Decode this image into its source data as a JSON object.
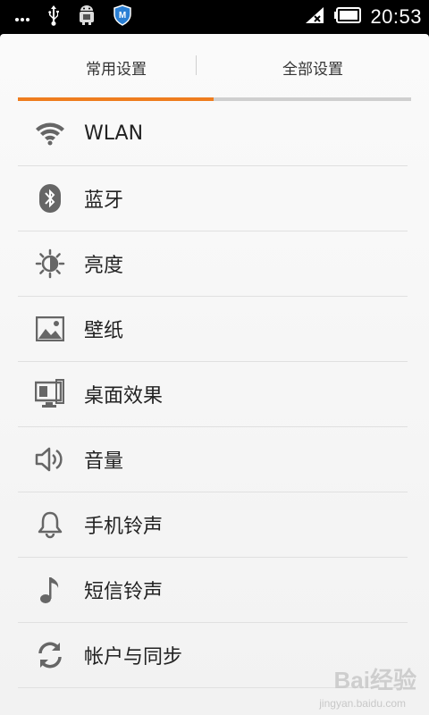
{
  "statusbar": {
    "time": "20:53",
    "left_icons": [
      "more-dots-icon",
      "usb-icon",
      "android-debug-icon",
      "security-shield-icon"
    ],
    "right_icons": [
      "signal-off-icon",
      "battery-icon"
    ]
  },
  "tabs": [
    {
      "label": "常用设置",
      "active": true
    },
    {
      "label": "全部设置",
      "active": false
    }
  ],
  "accent_color": "#ef7d1e",
  "items": [
    {
      "label": "WLAN",
      "icon": "wifi-icon"
    },
    {
      "label": "蓝牙",
      "icon": "bluetooth-icon"
    },
    {
      "label": "亮度",
      "icon": "brightness-icon"
    },
    {
      "label": "壁纸",
      "icon": "wallpaper-icon"
    },
    {
      "label": "桌面效果",
      "icon": "desktop-effect-icon"
    },
    {
      "label": "音量",
      "icon": "volume-icon"
    },
    {
      "label": "手机铃声",
      "icon": "bell-icon"
    },
    {
      "label": "短信铃声",
      "icon": "music-note-icon"
    },
    {
      "label": "帐户与同步",
      "icon": "sync-icon"
    }
  ],
  "watermark": {
    "brand": "Bai经验",
    "url": "jingyan.baidu.com"
  }
}
